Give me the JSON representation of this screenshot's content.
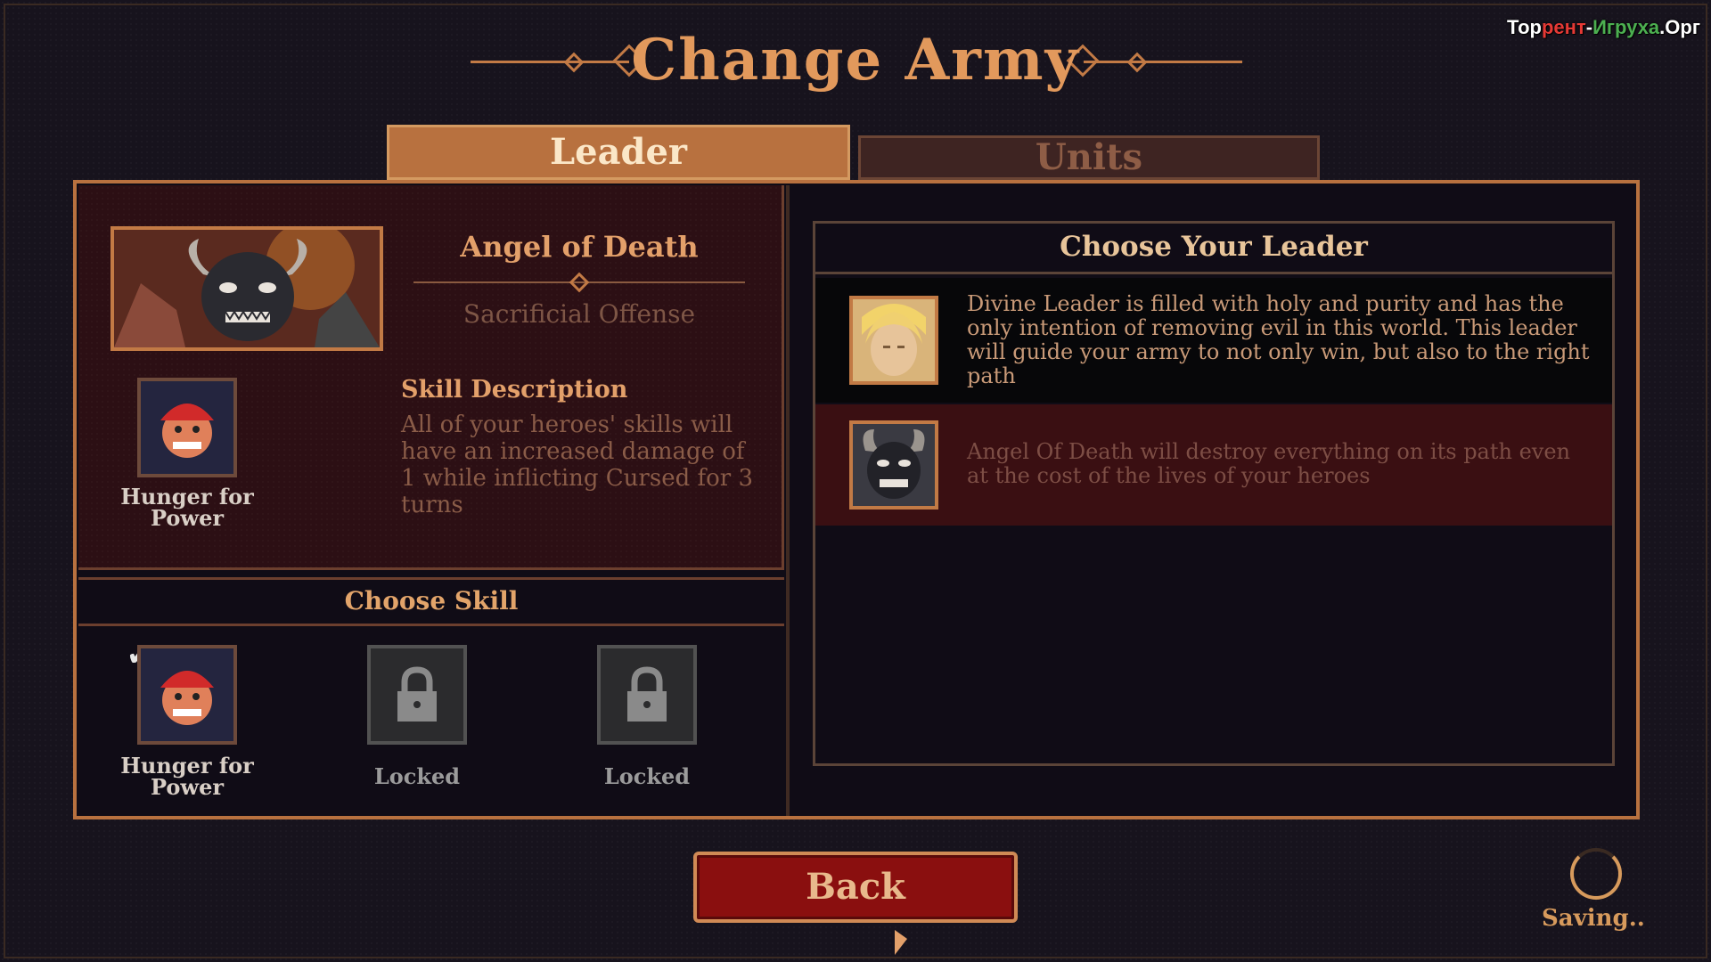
{
  "watermark": {
    "part1": "Тор",
    "part2": "рент",
    "part3": "-",
    "part4": "Игруха",
    "part5": ".Орг"
  },
  "title": "Change Army",
  "tabs": {
    "leader": "Leader",
    "units": "Units"
  },
  "selected_leader": {
    "name": "Angel of Death",
    "subtitle": "Sacrificial Offense",
    "skill_icon_label": "Hunger for Power",
    "skill_description_title": "Skill Description",
    "skill_description": "All of your heroes' skills will have an increased damage of 1 while inflicting Cursed for 3 turns"
  },
  "choose_skill": {
    "header": "Choose Skill",
    "skills": [
      {
        "label": "Hunger for Power",
        "selected": true
      },
      {
        "label": "Locked"
      },
      {
        "label": "Locked"
      }
    ]
  },
  "choose_leader": {
    "header": "Choose Your Leader",
    "leaders": [
      {
        "description": "Divine Leader is filled with holy and purity and has the only intention of removing evil in this world. This leader will guide your army to not only win, but also to the right path",
        "icon": "divine-leader-portrait"
      },
      {
        "description": "Angel Of Death will destroy everything on its path even at the cost of the lives of your heroes",
        "icon": "angel-of-death-portrait",
        "selected": true
      }
    ]
  },
  "back_label": "Back",
  "saving_label": "Saving..",
  "colors": {
    "accent": "#c27a45",
    "button": "#8a0f0f",
    "selected_row": "#3a0f12"
  }
}
